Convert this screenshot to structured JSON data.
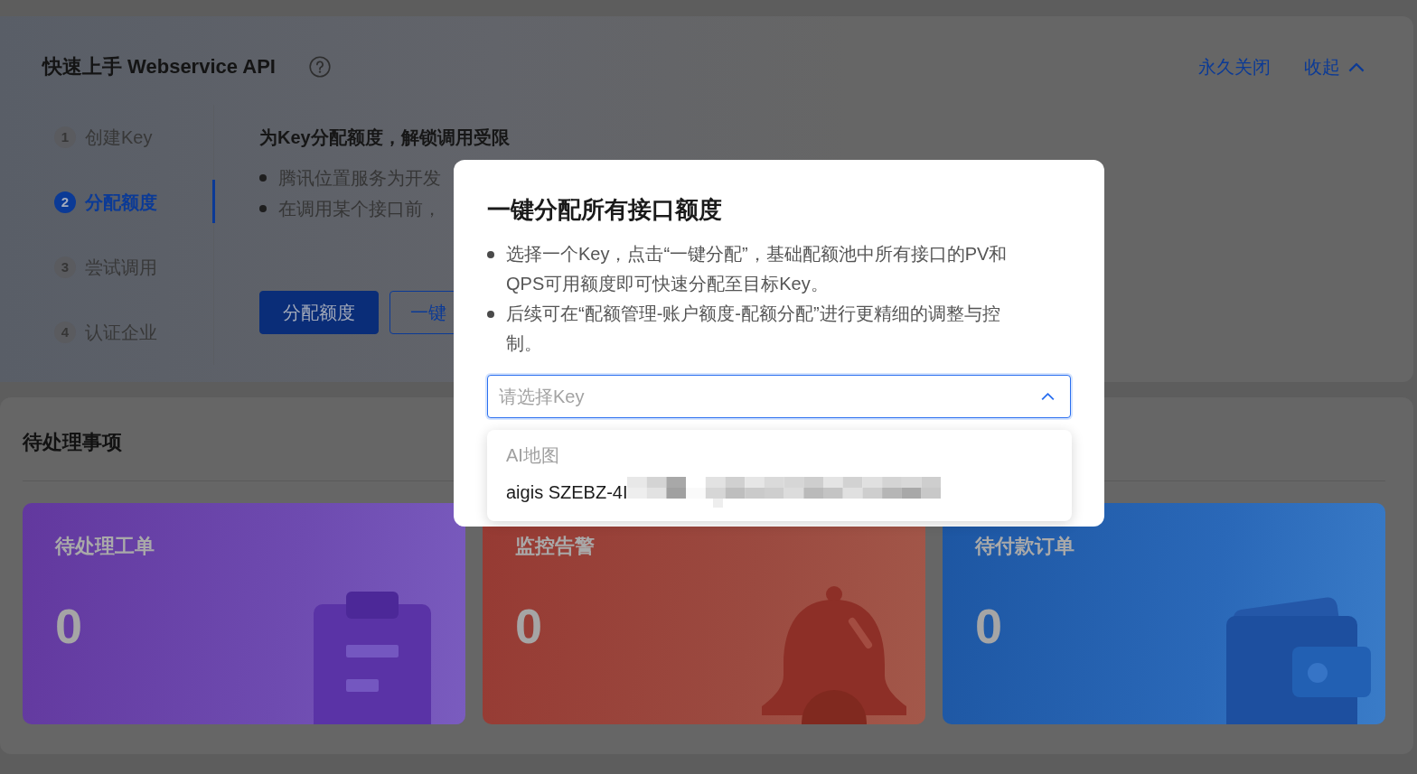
{
  "quick_start": {
    "title": "快速上手 Webservice API",
    "actions": [
      {
        "label": "永久关闭",
        "kind": "dismiss"
      },
      {
        "label": "收起",
        "kind": "collapse"
      }
    ],
    "steps": [
      {
        "number": "1",
        "label": "创建Key",
        "selected": false
      },
      {
        "number": "2",
        "label": "分配额度",
        "selected": true
      },
      {
        "number": "3",
        "label": "尝试调用",
        "selected": false
      },
      {
        "number": "4",
        "label": "认证企业",
        "selected": false
      }
    ],
    "content": {
      "heading": "为Key分配额度，解锁调用受限",
      "bullets": [
        "腾讯位置服务为开发",
        "在调用某个接口前，"
      ],
      "buttons": [
        {
          "label": "分配额度",
          "kind": "primary"
        },
        {
          "label": "一键",
          "kind": "outline"
        }
      ]
    }
  },
  "pending": {
    "title": "待处理事项",
    "cards": [
      {
        "title": "待处理工单",
        "count": "0",
        "kind": "clipboard"
      },
      {
        "title": "监控告警",
        "count": "0",
        "kind": "bell"
      },
      {
        "title": "待付款订单",
        "count": "0",
        "kind": "wallet"
      }
    ]
  },
  "modal": {
    "title": "一键分配所有接口额度",
    "bullets": [
      "选择一个Key，点击“一键分配”，基础配额池中所有接口的PV和QPS可用额度即可快速分配至目标Key。",
      "后续可在“配额管理-账户额度-配额分配”进行更精细的调整与控制。"
    ],
    "select": {
      "placeholder": "请选择Key",
      "expanded": true,
      "groups": [
        {
          "label": "AI地图",
          "options": [
            {
              "label": "aigis SZEBZ-4I",
              "redacted": true
            }
          ]
        }
      ]
    }
  }
}
